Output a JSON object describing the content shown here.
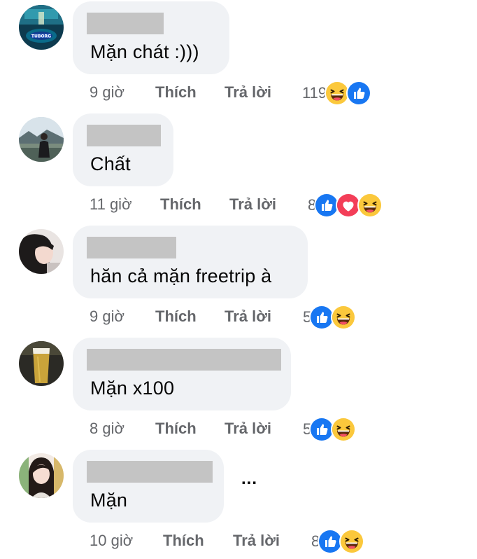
{
  "colors": {
    "bubble_bg": "#f0f2f5",
    "meta_text": "#65676b",
    "like_blue": "#1877f2",
    "love_red": "#f33e58",
    "haha_yellow": "#fcd045",
    "redaction_gray": "#c4c4c4"
  },
  "actions": {
    "like_label": "Thích",
    "reply_label": "Trả lời"
  },
  "comments": [
    {
      "text": "Mặn chát :)))",
      "time": "9 giờ",
      "reaction_count": "119",
      "reactions": [
        "haha-icon",
        "like-icon"
      ],
      "avatar": "avatar-tuborg"
    },
    {
      "text": "Chất",
      "time": "11 giờ",
      "reaction_count": "8",
      "reactions": [
        "like-icon",
        "love-icon",
        "haha-icon"
      ],
      "avatar": "avatar-landscape-person"
    },
    {
      "text": "hăn cả mặn freetrip à",
      "time": "9 giờ",
      "reaction_count": "5",
      "reactions": [
        "like-icon",
        "haha-icon"
      ],
      "avatar": "avatar-woman"
    },
    {
      "text": "Mặn x100",
      "time": "8 giờ",
      "reaction_count": "5",
      "reactions": [
        "like-icon",
        "haha-icon"
      ],
      "avatar": "avatar-beer-glass"
    },
    {
      "text": "Mặn",
      "time": "10 giờ",
      "reaction_count": "8",
      "reactions": [
        "like-icon",
        "haha-icon"
      ],
      "avatar": "avatar-girl",
      "more_options": "..."
    }
  ]
}
